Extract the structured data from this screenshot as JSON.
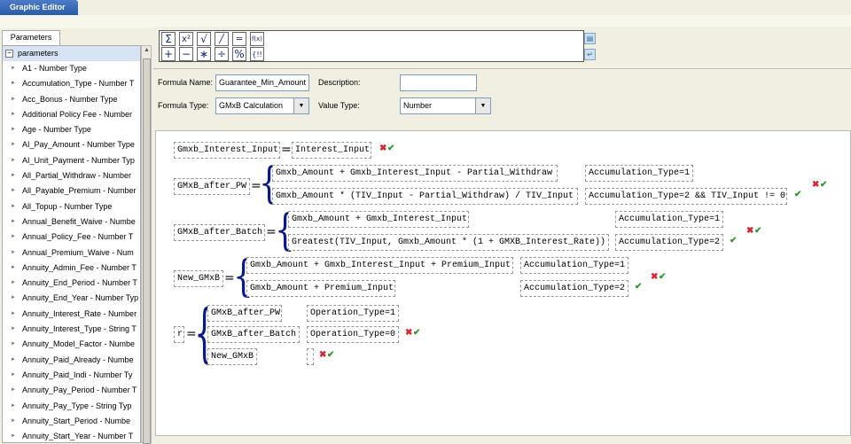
{
  "app": {
    "title": "Graphic Editor"
  },
  "left": {
    "tab": "Parameters",
    "root": "parameters",
    "items": [
      "A1 - Number Type",
      "Accumulation_Type - Number T",
      "Acc_Bonus - Number Type",
      "Additional Policy Fee - Number",
      "Age - Number Type",
      "AI_Pay_Amount - Number Type",
      "AI_Unit_Payment - Number Typ",
      "All_Partial_Withdraw - Number",
      "All_Payable_Premium - Number",
      "All_Topup - Number Type",
      "Annual_Benefit_Waive - Numbe",
      "Annual_Policy_Fee - Number T",
      "Annual_Premium_Waive - Num",
      "Annuity_Admin_Fee - Number T",
      "Annuity_End_Period - Number T",
      "Annuity_End_Year - Number Typ",
      "Annuity_Interest_Rate - Number",
      "Annuity_Interest_Type - String T",
      "Annuity_Model_Factor - Numbe",
      "Annuity_Paid_Already - Numbe",
      "Annuity_Paid_Indi - Number Ty",
      "Annuity_Pay_Period - Number T",
      "Annuity_Pay_Type - String Typ",
      "Annuity_Start_Period - Numbe",
      "Annuity_Start_Year - Number T"
    ]
  },
  "toolbar": {
    "buttons": [
      "Σ",
      "x²",
      "√",
      "╱",
      "═",
      "f(x)",
      "+",
      "−",
      "∗",
      "÷",
      "%",
      "{!!"
    ]
  },
  "form": {
    "formula_name_label": "Formula Name:",
    "formula_name_value": "Guarantee_Min_Amount",
    "description_label": "Description:",
    "description_value": "",
    "formula_type_label": "Formula Type:",
    "formula_type_value": "GMxB Calculation",
    "value_type_label": "Value Type:",
    "value_type_value": "Number"
  },
  "canvas": {
    "r1": {
      "lhs": "Gmxb_Interest_Input",
      "rhs": "Interest_Input"
    },
    "r2": {
      "lhs": "GMxB_after_PW",
      "exp1": "Gmxb_Amount + Gmxb_Interest_Input - Partial_Withdraw",
      "cond1": "Accumulation_Type=1",
      "exp2": "Gmxb_Amount * (TIV_Input - Partial_Withdraw) / TIV_Input",
      "cond2": "Accumulation_Type=2 && TIV_Input != 0"
    },
    "r3": {
      "lhs": "GMxB_after_Batch",
      "exp1": "Gmxb_Amount + Gmxb_Interest_Input",
      "cond1": "Accumulation_Type=1",
      "exp2": "Greatest(TIV_Input, Gmxb_Amount * (1 + GMXB_Interest_Rate))",
      "cond2": "Accumulation_Type=2"
    },
    "r4": {
      "lhs": "New_GMxB",
      "exp1": "Gmxb_Amount + Gmxb_Interest_Input + Premium_Input",
      "cond1": "Accumulation_Type=1",
      "exp2": "Gmxb_Amount + Premium_Input",
      "cond2": "Accumulation_Type=2"
    },
    "r5": {
      "lhs": "r",
      "exp1": "GMxB_after_PW",
      "cond1": "Operation_Type=1",
      "exp2": "GMxB_after_Batch",
      "cond2": "Operation_Type=0",
      "exp3": "New_GMxB"
    }
  },
  "colors": {
    "accent": "#2a5ba8",
    "brace": "#0a1a8a",
    "delete": "#dd2233",
    "ok": "#2a9a2a"
  }
}
